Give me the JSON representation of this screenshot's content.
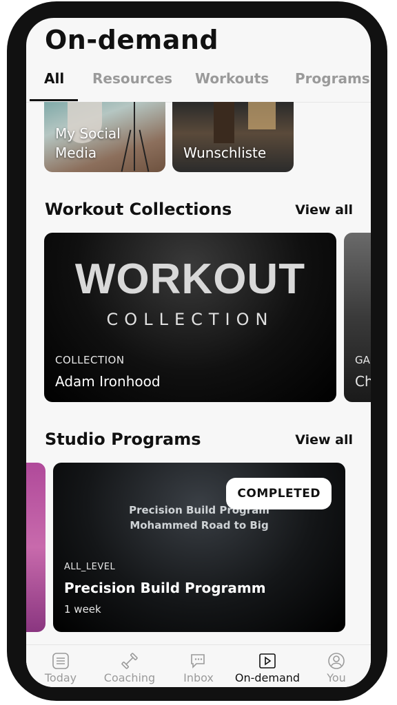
{
  "page": {
    "title": "On-demand"
  },
  "tabs": [
    {
      "label": "All",
      "active": true
    },
    {
      "label": "Resources",
      "active": false
    },
    {
      "label": "Workouts",
      "active": false
    },
    {
      "label": "Programs",
      "active": false
    }
  ],
  "resources": [
    {
      "label_line1": "My Social",
      "label_line2": "Media"
    },
    {
      "label_line1": "Wunschliste",
      "label_line2": ""
    }
  ],
  "workout_collections": {
    "title": "Workout Collections",
    "view_all": "View all",
    "cards": [
      {
        "art_main": "WORKOUT",
        "art_sub": "COLLECTION",
        "kicker": "COLLECTION",
        "name": "Adam Ironhood"
      },
      {
        "kicker": "GA",
        "name": "Ch"
      }
    ]
  },
  "studio_programs": {
    "title": "Studio Programs",
    "view_all": "View all",
    "card": {
      "badge": "COMPLETED",
      "art_line1": "Precision Build Program",
      "art_line2": "Mohammed Road to Big",
      "level": "ALL_LEVEL",
      "name": "Precision Build Programm",
      "duration": "1 week"
    }
  },
  "bottom_nav": [
    {
      "label": "Today",
      "icon": "list-icon",
      "active": false
    },
    {
      "label": "Coaching",
      "icon": "dumbbell-icon",
      "active": false
    },
    {
      "label": "Inbox",
      "icon": "chat-icon",
      "active": false
    },
    {
      "label": "On-demand",
      "icon": "play-icon",
      "active": true
    },
    {
      "label": "You",
      "icon": "user-icon",
      "active": false
    }
  ],
  "colors": {
    "accent_text": "#111111",
    "inactive_text": "#9a9a9a",
    "badge_bg": "#ffffff"
  }
}
